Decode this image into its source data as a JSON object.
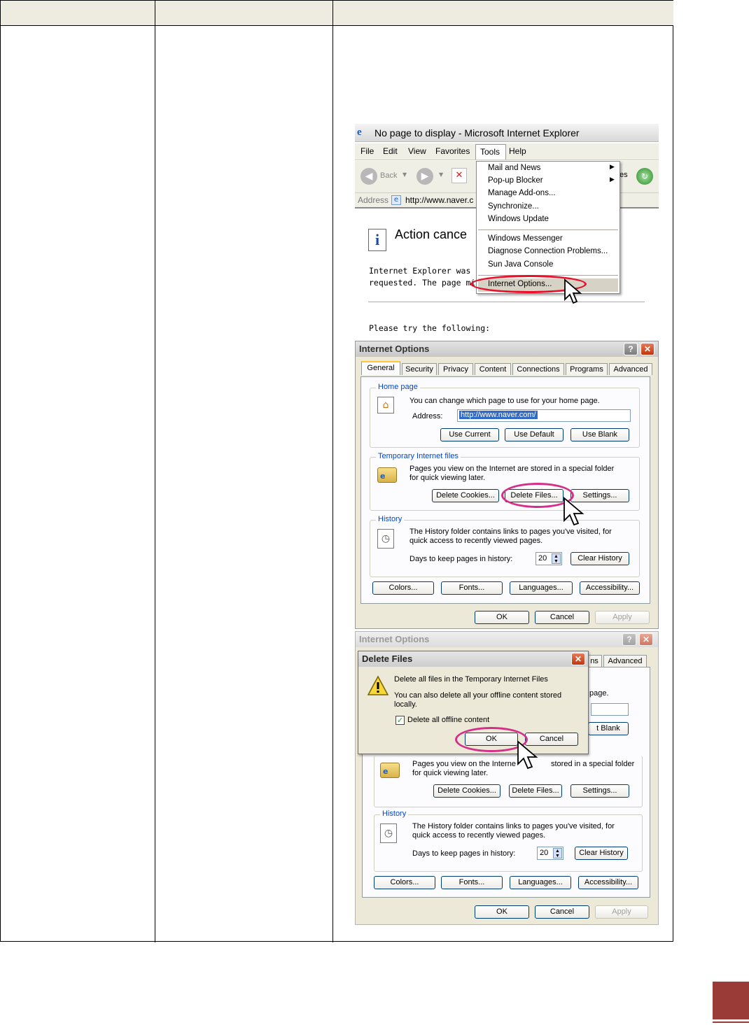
{
  "ie": {
    "title": "No page to display - Microsoft Internet Explorer",
    "menu": [
      "File",
      "Edit",
      "View",
      "Favorites",
      "Tools",
      "Help"
    ],
    "back_label": "Back",
    "address_label": "Address",
    "address_value": "http://www.naver.c",
    "action_title": "Action cance",
    "body_line1": "Internet Explorer was una",
    "body_line2": "requested. The page mig",
    "try_text": "Please try the following:",
    "toolbar_fragment": "es",
    "tools_menu": [
      "Mail and News",
      "Pop-up Blocker",
      "Manage Add-ons...",
      "Synchronize...",
      "Windows Update",
      "Windows Messenger",
      "Diagnose Connection Problems...",
      "Sun Java Console",
      "Internet Options..."
    ]
  },
  "io1": {
    "title": "Internet Options",
    "help_btn": "?",
    "close_btn": "✕",
    "tabs": [
      "General",
      "Security",
      "Privacy",
      "Content",
      "Connections",
      "Programs",
      "Advanced"
    ],
    "home_group": "Home page",
    "home_desc": "You can change which page to use for your home page.",
    "address_label": "Address:",
    "address_value": "http://www.naver.com/",
    "use_current": "Use Current",
    "use_default": "Use Default",
    "use_blank": "Use Blank",
    "temp_group": "Temporary Internet files",
    "temp_desc1": "Pages you view on the Internet are stored in a special folder",
    "temp_desc2": "for quick viewing later.",
    "delete_cookies": "Delete Cookies...",
    "delete_files": "Delete Files...",
    "settings": "Settings...",
    "history_group": "History",
    "history_desc1": "The History folder contains links to pages you've visited, for",
    "history_desc2": "quick access to recently viewed pages.",
    "days_label": "Days to keep pages in history:",
    "days_value": "20",
    "clear_history": "Clear History",
    "colors": "Colors...",
    "fonts": "Fonts...",
    "languages": "Languages...",
    "accessibility": "Accessibility...",
    "ok": "OK",
    "cancel": "Cancel",
    "apply": "Apply"
  },
  "io2": {
    "title": "Internet Options",
    "help_btn": "?",
    "close_btn": "✕",
    "tab_ns": "ns",
    "tab_advanced": "Advanced",
    "page_fragment": "page.",
    "blank_fragment": "t Blank",
    "temp_desc1a": "Pages you view on the Interne",
    "temp_desc1b": "stored in a special folder",
    "temp_desc2": "for quick viewing later.",
    "delete_cookies": "Delete Cookies...",
    "delete_files": "Delete Files...",
    "settings": "Settings...",
    "history_group": "History",
    "history_desc1": "The History folder contains links to pages you've visited, for",
    "history_desc2": "quick access to recently viewed pages.",
    "days_label": "Days to keep pages in history:",
    "days_value": "20",
    "clear_history": "Clear History",
    "colors": "Colors...",
    "fonts": "Fonts...",
    "languages": "Languages...",
    "accessibility": "Accessibility...",
    "ok": "OK",
    "cancel": "Cancel",
    "apply": "Apply"
  },
  "delete_dialog": {
    "title": "Delete Files",
    "close_btn": "✕",
    "line1": "Delete all files in the Temporary Internet Files",
    "line2": "You can also delete all your offline content stored",
    "line3": "locally.",
    "checkbox_label": "Delete all offline content",
    "checkbox_checked": true,
    "ok": "OK",
    "cancel": "Cancel"
  }
}
